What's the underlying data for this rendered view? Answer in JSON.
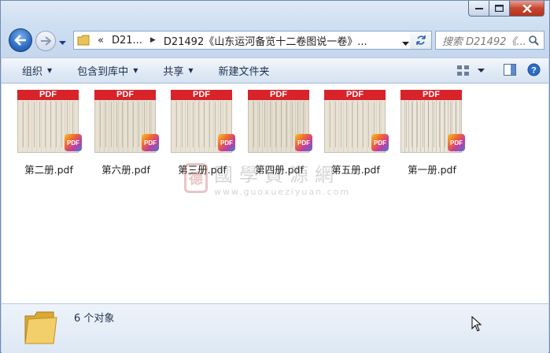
{
  "address": {
    "overflow_marker": "«",
    "segments": [
      "D21...",
      "D21492《山东运河备览十二卷图说一卷》..."
    ]
  },
  "search": {
    "placeholder": "搜索 D21492《..."
  },
  "toolbar": {
    "organize": "组织",
    "include_in_library": "包含到库中",
    "share": "共享",
    "new_folder": "新建文件夹"
  },
  "files": [
    {
      "name": "第二册.pdf",
      "banner": "PDF",
      "badge": "PDF"
    },
    {
      "name": "第六册.pdf",
      "banner": "PDF",
      "badge": "PDF"
    },
    {
      "name": "第三册.pdf",
      "banner": "PDF",
      "badge": "PDF"
    },
    {
      "name": "第四册.pdf",
      "banner": "PDF",
      "badge": "PDF"
    },
    {
      "name": "第五册.pdf",
      "banner": "PDF",
      "badge": "PDF"
    },
    {
      "name": "第一册.pdf",
      "banner": "PDF",
      "badge": "PDF"
    }
  ],
  "watermark": {
    "seal": "德",
    "title": "國學資源網",
    "url": "www.guoxueziyuan.com"
  },
  "details": {
    "count_text": "6 个对象"
  },
  "colors": {
    "pdf_red": "#d8232a",
    "window_frame": "#c4d6ee",
    "close_red": "#c9452e"
  }
}
